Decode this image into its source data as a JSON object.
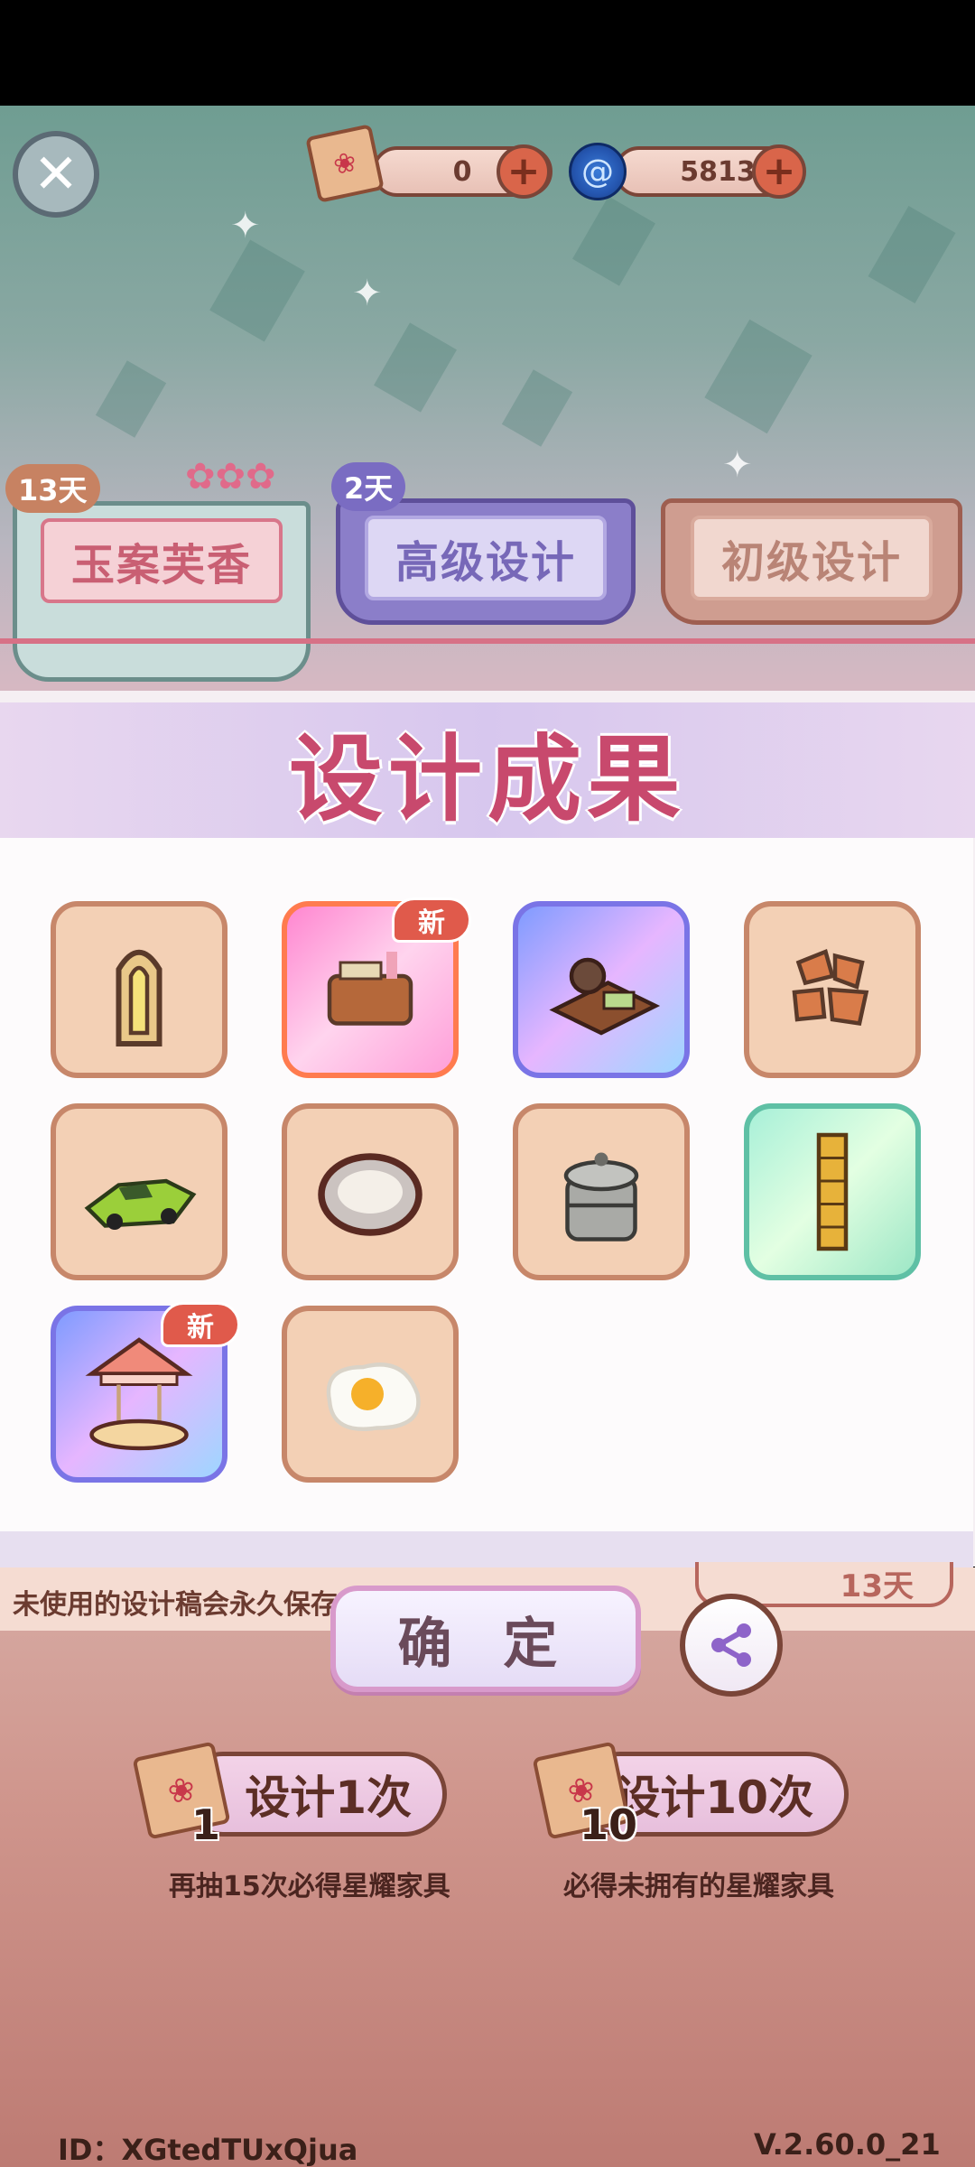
{
  "header": {
    "scroll_count": "0",
    "gem_count": "5813"
  },
  "tabs": [
    {
      "label": "玉案芙香",
      "days": "13天"
    },
    {
      "label": "高级设计",
      "days": "2天"
    },
    {
      "label": "初级设计",
      "days": ""
    }
  ],
  "modal": {
    "title": "设计成果",
    "items": [
      {
        "name": "arched-window",
        "rarity": "normal",
        "is_new": false
      },
      {
        "name": "tea-desk",
        "rarity": "pink",
        "is_new": true
      },
      {
        "name": "tea-set",
        "rarity": "blue",
        "is_new": false
      },
      {
        "name": "stone-tiles",
        "rarity": "normal",
        "is_new": false
      },
      {
        "name": "green-sports-car",
        "rarity": "normal",
        "is_new": false
      },
      {
        "name": "plate",
        "rarity": "normal",
        "is_new": false
      },
      {
        "name": "steamer-pot",
        "rarity": "normal",
        "is_new": false
      },
      {
        "name": "golden-screen",
        "rarity": "green",
        "is_new": false
      },
      {
        "name": "carousel",
        "rarity": "blue",
        "is_new": true
      },
      {
        "name": "fried-egg",
        "rarity": "normal",
        "is_new": false
      }
    ],
    "new_badge": "新",
    "confirm_label": "确 定"
  },
  "info": {
    "note": "未使用的设计稿会永久保存",
    "days": "13天"
  },
  "actions": {
    "design_once_label": "设计1次",
    "design_once_count": "1",
    "design_once_hint": "再抽15次必得星耀家具",
    "design_ten_label": "设计10次",
    "design_ten_count": "10",
    "design_ten_hint": "必得未拥有的星耀家具"
  },
  "footer": {
    "user_id": "ID：XGtedTUxQjua",
    "version": "V.2.60.0_21"
  },
  "colors": {
    "accent": "#c8496d",
    "badge": "#e05a4b"
  }
}
